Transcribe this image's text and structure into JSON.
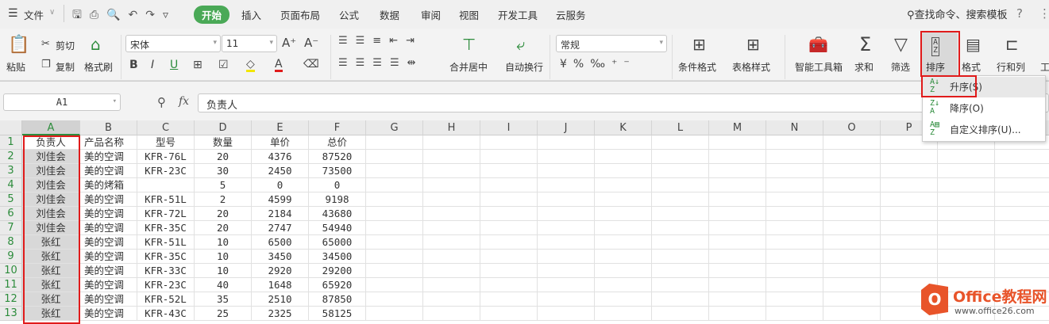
{
  "menu_bar": {
    "file": "文件",
    "tabs": [
      "开始",
      "插入",
      "页面布局",
      "公式",
      "数据",
      "审阅",
      "视图",
      "开发工具",
      "云服务"
    ],
    "search": "查找命令、搜索模板",
    "help": "?"
  },
  "ribbon": {
    "paste": "粘贴",
    "cut": "剪切",
    "copy": "复制",
    "format_painter": "格式刷",
    "font": "宋体",
    "font_size": "11",
    "merge_center": "合并居中",
    "wrap": "自动换行",
    "number_format": "常规",
    "conditional_format": "条件格式",
    "table_style": "表格样式",
    "smart_toolbox": "智能工具箱",
    "sum": "求和",
    "filter": "筛选",
    "sort": "排序",
    "format": "格式",
    "row_col": "行和列",
    "work": "工"
  },
  "formula_bar": {
    "name_box": "A1",
    "fx": "fx",
    "content": "负责人"
  },
  "sort_menu": {
    "items": [
      "升序(S)",
      "降序(O)",
      "自定义排序(U)..."
    ]
  },
  "sheet": {
    "columns": [
      "A",
      "B",
      "C",
      "D",
      "E",
      "F",
      "G",
      "H",
      "I",
      "J",
      "K",
      "L",
      "M",
      "N",
      "O",
      "P"
    ],
    "rows": [
      [
        "负责人",
        "产品名称",
        "型号",
        "数量",
        "单价",
        "总价"
      ],
      [
        "刘佳会",
        "美的空调",
        "KFR-76L",
        "20",
        "4376",
        "87520"
      ],
      [
        "刘佳会",
        "美的空调",
        "KFR-23C",
        "30",
        "2450",
        "73500"
      ],
      [
        "刘佳会",
        "美的烤箱",
        "",
        "5",
        "0",
        "0"
      ],
      [
        "刘佳会",
        "美的空调",
        "KFR-51L",
        "2",
        "4599",
        "9198"
      ],
      [
        "刘佳会",
        "美的空调",
        "KFR-72L",
        "20",
        "2184",
        "43680"
      ],
      [
        "刘佳会",
        "美的空调",
        "KFR-35C",
        "20",
        "2747",
        "54940"
      ],
      [
        "张红",
        "美的空调",
        "KFR-51L",
        "10",
        "6500",
        "65000"
      ],
      [
        "张红",
        "美的空调",
        "KFR-35C",
        "10",
        "3450",
        "34500"
      ],
      [
        "张红",
        "美的空调",
        "KFR-33C",
        "10",
        "2920",
        "29200"
      ],
      [
        "张红",
        "美的空调",
        "KFR-23C",
        "40",
        "1648",
        "65920"
      ],
      [
        "张红",
        "美的空调",
        "KFR-52L",
        "35",
        "2510",
        "87850"
      ],
      [
        "张红",
        "美的空调",
        "KFR-43C",
        "25",
        "2325",
        "58125"
      ]
    ]
  },
  "watermark": {
    "title": "Office教程网",
    "url": "www.office26.com"
  },
  "colors": {
    "accent": "#4aa957",
    "highlight": "#e01b1b"
  }
}
